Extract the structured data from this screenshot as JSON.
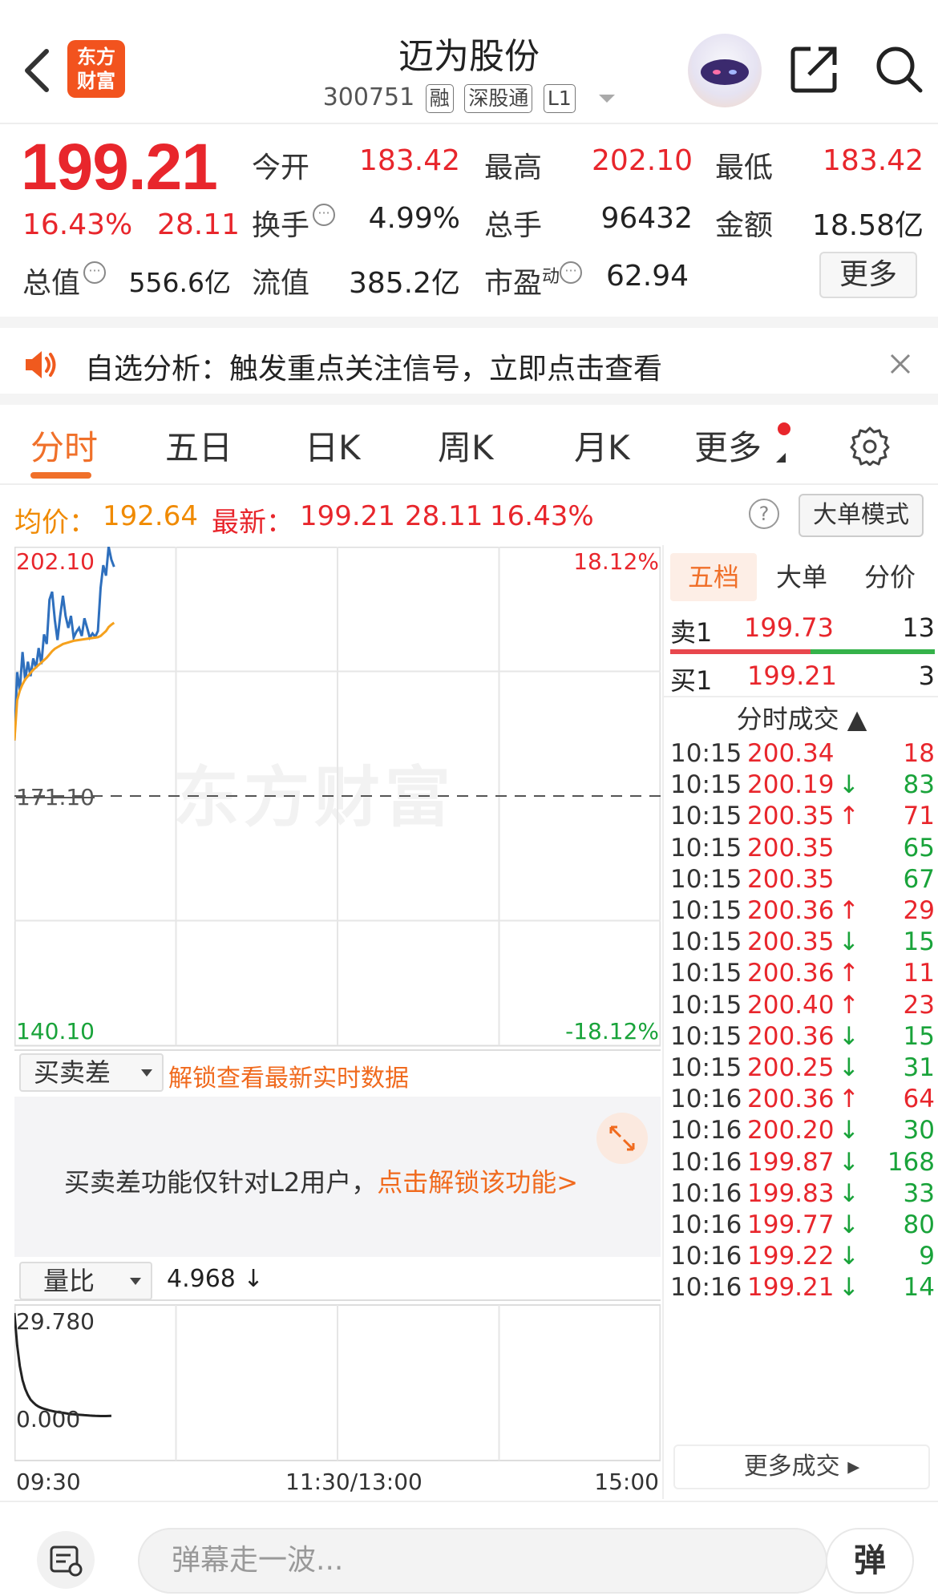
{
  "header": {
    "logo_text_1": "东方",
    "logo_text_2": "财富",
    "title": "迈为股份",
    "code": "300751",
    "tags": [
      "融",
      "深股通",
      "L1"
    ]
  },
  "quote": {
    "price": "199.21",
    "change_pct": "16.43%",
    "change_amt": "28.11",
    "fields": [
      {
        "label": "今开",
        "value": "183.42",
        "color": "red"
      },
      {
        "label": "最高",
        "value": "202.10",
        "color": "red"
      },
      {
        "label": "最低",
        "value": "183.42",
        "color": "red"
      },
      {
        "label": "换手",
        "value": "4.99%",
        "color": "black"
      },
      {
        "label": "总手",
        "value": "96432",
        "color": "black"
      },
      {
        "label": "金额",
        "value": "18.58亿",
        "color": "black"
      },
      {
        "label": "总值",
        "value": "556.6亿",
        "color": "black"
      },
      {
        "label": "流值",
        "value": "385.2亿",
        "color": "black"
      },
      {
        "label": "市盈",
        "value": "62.94",
        "color": "black"
      }
    ],
    "pe_superscript": "动",
    "more_label": "更多"
  },
  "banner": {
    "text": "自选分析：触发重点关注信号，立即点击查看"
  },
  "tabs": {
    "items": [
      "分时",
      "五日",
      "日K",
      "周K",
      "月K",
      "更多"
    ],
    "active": "分时"
  },
  "chart_head": {
    "avg_label": "均价：",
    "avg_value": "192.64",
    "latest_label": "最新：",
    "latest_value": "199.21",
    "latest_chg": "28.11",
    "latest_pct": "16.43%",
    "help": "?",
    "bigorder_label": "大单模式"
  },
  "chart_labels": {
    "y_top": "202.10",
    "y_mid": "171.10",
    "y_bottom": "140.10",
    "pct_top": "18.12%",
    "pct_bottom": "-18.12%",
    "watermark": "东方财富",
    "x_start": "09:30",
    "x_mid": "11:30/13:00",
    "x_end": "15:00"
  },
  "chart_data": {
    "type": "line",
    "y_range": [
      140.1,
      202.1
    ],
    "prev_close": 171.1,
    "series": [
      {
        "name": "最新",
        "color": "#2e6fbd",
        "values": [
          178.0,
          186.5,
          184.2,
          189.0,
          185.5,
          187.8,
          186.0,
          188.2,
          187.0,
          189.5,
          187.5,
          191.2,
          190.0,
          195.5,
          196.5,
          193.0,
          190.5,
          193.5,
          196.0,
          193.5,
          192.0,
          193.5,
          190.8,
          191.5,
          192.0,
          191.0,
          193.2,
          192.0,
          190.8,
          191.3,
          190.9,
          191.6,
          197.0,
          199.8,
          198.5,
          202.1,
          200.5,
          199.6
        ]
      },
      {
        "name": "均价",
        "color": "#f5a11d",
        "values": [
          178.0,
          183.0,
          184.2,
          185.0,
          185.6,
          186.0,
          186.4,
          186.8,
          187.1,
          187.4,
          187.7,
          188.0,
          188.3,
          188.7,
          189.1,
          189.4,
          189.6,
          189.8,
          190.0,
          190.1,
          190.2,
          190.3,
          190.4,
          190.45,
          190.5,
          190.55,
          190.6,
          190.65,
          190.7,
          190.75,
          190.8,
          190.85,
          191.0,
          191.3,
          191.6,
          192.1,
          192.4,
          192.64
        ]
      }
    ],
    "total_points": 241
  },
  "indicators": {
    "sub1_label": "买卖差",
    "sub1_unlock": "解锁查看最新实时数据",
    "lock_text": "买卖差功能仅针对L2用户，",
    "lock_link": "点击解锁该功能>",
    "sub2_label": "量比",
    "sub2_value": "4.968 ↓",
    "vol_top": "29.780",
    "vol_bottom": "0.000"
  },
  "volume_ratio_data": {
    "type": "line",
    "y_range": [
      0,
      29.78
    ],
    "values": [
      29.78,
      22.0,
      17.0,
      13.6,
      11.5,
      10.0,
      8.9,
      8.2,
      7.6,
      7.2,
      6.9,
      6.7,
      6.5,
      6.3,
      6.15,
      6.0,
      5.9,
      5.8,
      5.7,
      5.6,
      5.5,
      5.4,
      5.35,
      5.3,
      5.25,
      5.2,
      5.15,
      5.1,
      5.05,
      5.0,
      4.97,
      4.95,
      4.94,
      4.93,
      4.94,
      4.96,
      4.968
    ],
    "total_points": 241
  },
  "right_panel": {
    "tabs": [
      "五档",
      "大单",
      "分价"
    ],
    "sell1": {
      "label": "卖1",
      "price": "199.73",
      "vol": "13"
    },
    "buy1": {
      "label": "买1",
      "price": "199.21",
      "vol": "3"
    },
    "ticks_title": "分时成交 ▲",
    "ticks": [
      {
        "time": "10:15",
        "price": "200.34",
        "arrow": "",
        "vol": "18",
        "vol_color": "red"
      },
      {
        "time": "10:15",
        "price": "200.19",
        "arrow": "↓",
        "vol": "83",
        "vol_color": "green"
      },
      {
        "time": "10:15",
        "price": "200.35",
        "arrow": "↑",
        "vol": "71",
        "vol_color": "red"
      },
      {
        "time": "10:15",
        "price": "200.35",
        "arrow": "",
        "vol": "65",
        "vol_color": "green"
      },
      {
        "time": "10:15",
        "price": "200.35",
        "arrow": "",
        "vol": "67",
        "vol_color": "green"
      },
      {
        "time": "10:15",
        "price": "200.36",
        "arrow": "↑",
        "vol": "29",
        "vol_color": "red"
      },
      {
        "time": "10:15",
        "price": "200.35",
        "arrow": "↓",
        "vol": "15",
        "vol_color": "green"
      },
      {
        "time": "10:15",
        "price": "200.36",
        "arrow": "↑",
        "vol": "11",
        "vol_color": "red"
      },
      {
        "time": "10:15",
        "price": "200.40",
        "arrow": "↑",
        "vol": "23",
        "vol_color": "red"
      },
      {
        "time": "10:15",
        "price": "200.36",
        "arrow": "↓",
        "vol": "15",
        "vol_color": "green"
      },
      {
        "time": "10:15",
        "price": "200.25",
        "arrow": "↓",
        "vol": "31",
        "vol_color": "green"
      },
      {
        "time": "10:16",
        "price": "200.36",
        "arrow": "↑",
        "vol": "64",
        "vol_color": "red"
      },
      {
        "time": "10:16",
        "price": "200.20",
        "arrow": "↓",
        "vol": "30",
        "vol_color": "green"
      },
      {
        "time": "10:16",
        "price": "199.87",
        "arrow": "↓",
        "vol": "168",
        "vol_color": "green"
      },
      {
        "time": "10:16",
        "price": "199.83",
        "arrow": "↓",
        "vol": "33",
        "vol_color": "green"
      },
      {
        "time": "10:16",
        "price": "199.77",
        "arrow": "↓",
        "vol": "80",
        "vol_color": "green"
      },
      {
        "time": "10:16",
        "price": "199.22",
        "arrow": "↓",
        "vol": "9",
        "vol_color": "green"
      },
      {
        "time": "10:16",
        "price": "199.21",
        "arrow": "↓",
        "vol": "14",
        "vol_color": "green"
      }
    ],
    "more_label": "更多成交 ▸"
  },
  "bottom": {
    "placeholder": "弹幕走一波...",
    "danmu_btn": "弹"
  }
}
